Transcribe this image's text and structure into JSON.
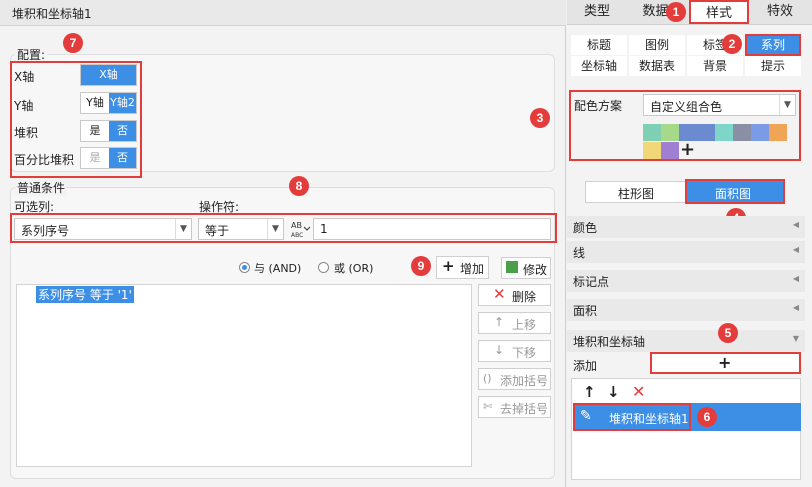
{
  "window": {
    "title": "堆积和坐标轴1"
  },
  "config": {
    "legend": "配置:",
    "rows": [
      {
        "label": "X轴",
        "options": [
          "X轴"
        ],
        "selected": 0
      },
      {
        "label": "Y轴",
        "options": [
          "Y轴",
          "Y轴2"
        ],
        "selected": 1
      },
      {
        "label": "堆积",
        "options": [
          "是",
          "否"
        ],
        "selected": 1
      },
      {
        "label": "百分比堆积",
        "options": [
          "是",
          "否"
        ],
        "selected": 1,
        "disabled_option": 0
      }
    ]
  },
  "condition": {
    "legend": "普通条件",
    "field_label": "可选列:",
    "operator_label": "操作符:",
    "field_value": "系列序号",
    "operator_value": "等于",
    "value": "1",
    "and_label": "与 (AND)",
    "or_label": "或 (OR)",
    "logic_selected": "and",
    "add_button": "增加",
    "modify_button": "修改",
    "list": [
      "系列序号 等于 '1'"
    ],
    "delete_button": "删除",
    "up_button": "上移",
    "down_button": "下移",
    "add_bracket_button": "添加括号",
    "remove_bracket_button": "去掉括号"
  },
  "right_panel": {
    "top_tabs": [
      "类型",
      "数据",
      "样式",
      "特效"
    ],
    "active_tab": "样式",
    "sub_tabs_row1": [
      "标题",
      "图例",
      "标签",
      "系列"
    ],
    "sub_tabs_row2": [
      "坐标轴",
      "数据表",
      "背景",
      "提示"
    ],
    "active_sub_tab": "系列",
    "color_scheme_label": "配色方案",
    "color_scheme_value": "自定义组合色",
    "colors": [
      "#7ecfb3",
      "#a7d98b",
      "#6b8ad0",
      "#6b8ad0",
      "#7ed6c9",
      "#8a8fa3",
      "#7b9be6",
      "#f0a455",
      "#f0d778",
      "#9f7fd1"
    ],
    "chart_types": [
      "柱形图",
      "面积图"
    ],
    "active_chart_type": "面积图",
    "sections": [
      "颜色",
      "线",
      "标记点",
      "面积"
    ],
    "stack_section": "堆积和坐标轴",
    "add_label": "添加",
    "list_item": "堆积和坐标轴1"
  },
  "badges": [
    "1",
    "2",
    "3",
    "4",
    "5",
    "6",
    "7",
    "8",
    "9"
  ]
}
